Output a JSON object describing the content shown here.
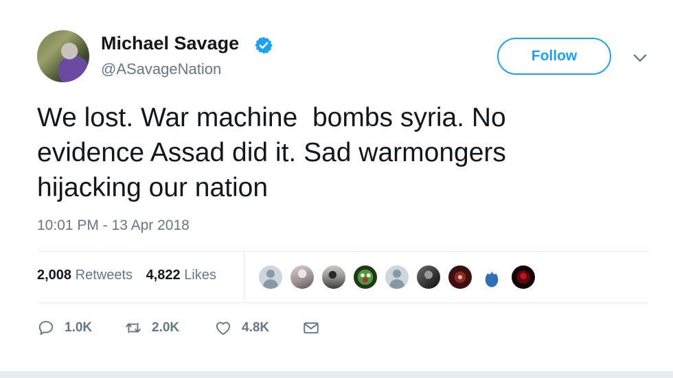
{
  "header": {
    "display_name": "Michael Savage",
    "handle": "@ASavageNation",
    "follow_label": "Follow"
  },
  "tweet": {
    "text": "We lost. War machine  bombs syria. No\nevidence Assad did it. Sad warmongers\nhijacking our nation",
    "timestamp": "10:01 PM - 13 Apr 2018"
  },
  "stats": {
    "retweets_count": "2,008",
    "retweets_label": "Retweets",
    "likes_count": "4,822",
    "likes_label": "Likes"
  },
  "liker_avatars": [
    "default-avatar",
    "anime-avatar",
    "dark-figure-avatar",
    "pepe-frog-avatar",
    "default-avatar",
    "grayscale-avatar",
    "red-emblem-avatar",
    "cookie-monster-avatar",
    "red-dark-avatar"
  ],
  "actions": {
    "replies": "1.0K",
    "retweets": "2.0K",
    "likes": "4.8K"
  },
  "colors": {
    "accent": "#1da1f2",
    "secondary_text": "#657786",
    "primary_text": "#14171a",
    "divider": "#e6ecf0"
  },
  "icons": {
    "verified": "verified-badge-icon",
    "caret": "chevron-down-icon",
    "reply": "reply-icon",
    "retweet": "retweet-icon",
    "like": "heart-icon",
    "dm": "envelope-icon"
  }
}
